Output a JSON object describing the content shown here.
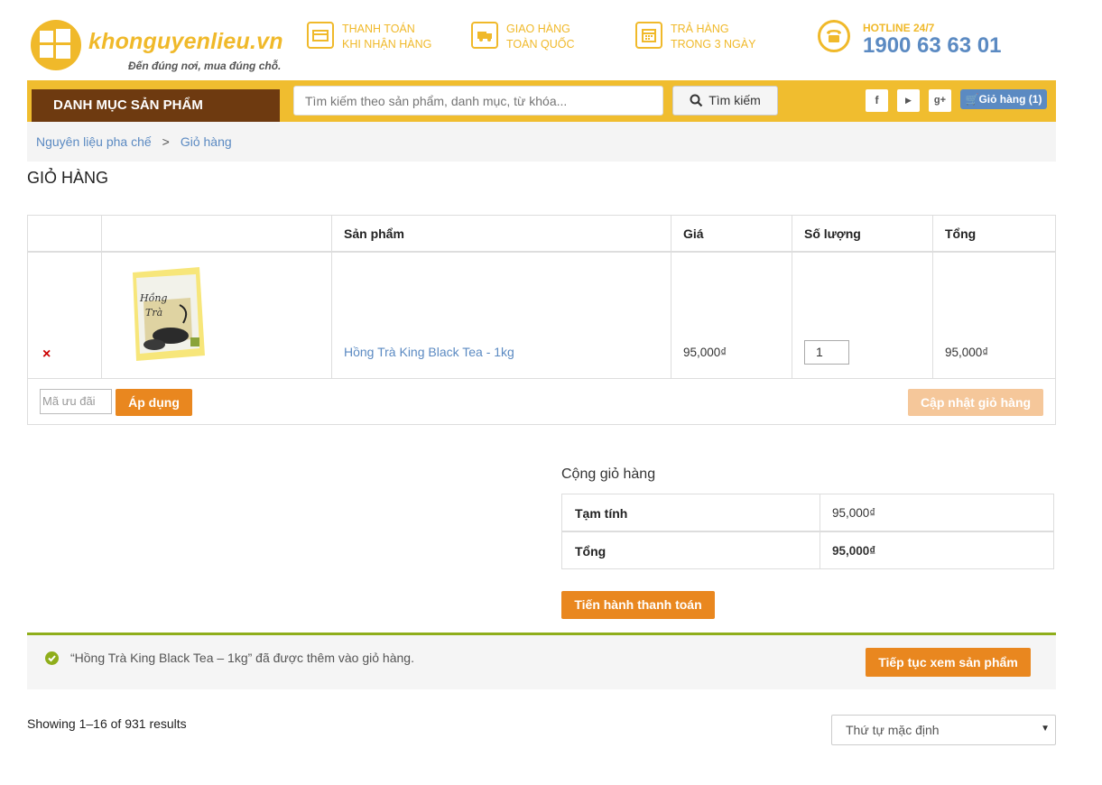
{
  "header": {
    "logo_name": "khonguyenlieu.vn",
    "logo_slogan": "Đến đúng nơi, mua đúng chỗ.",
    "features": [
      {
        "line1": "THANH TOÁN",
        "line2": "KHI NHẬN HÀNG",
        "icon": "credit-card-icon"
      },
      {
        "line1": "GIAO HÀNG",
        "line2": "TOÀN QUỐC",
        "icon": "truck-icon"
      },
      {
        "line1": "TRẢ HÀNG",
        "line2": "TRONG 3 NGÀY",
        "icon": "calendar-icon"
      }
    ],
    "hotline_label": "HOTLINE 24/7",
    "hotline_number": "1900 63 63 01"
  },
  "nav": {
    "category_label": "DANH MỤC SẢN PHẨM",
    "search_placeholder": "Tìm kiếm theo sản phẩm, danh mục, từ khóa...",
    "search_button": "Tìm kiếm",
    "social": [
      "f",
      "▶",
      "g+"
    ],
    "cart_label": "Giỏ hàng (1)"
  },
  "breadcrumb": {
    "home": "Nguyên liệu pha chế",
    "separator": ">",
    "current": "Giỏ hàng"
  },
  "page_title": "GIỎ HÀNG",
  "cart": {
    "headers": {
      "product": "Sản phẩm",
      "price": "Giá",
      "quantity": "Số lượng",
      "total": "Tổng"
    },
    "items": [
      {
        "remove": "×",
        "name": "Hồng Trà King Black Tea - 1kg",
        "price": "95,000₫",
        "quantity": "1",
        "total": "95,000₫"
      }
    ],
    "coupon_placeholder": "Mã ưu đãi",
    "apply_button": "Áp dụng",
    "update_button": "Cập nhật giỏ hàng"
  },
  "totals": {
    "title": "Cộng giỏ hàng",
    "subtotal_label": "Tạm tính",
    "subtotal_value": "95,000₫",
    "total_label": "Tổng",
    "total_value": "95,000₫",
    "checkout_button": "Tiến hành thanh toán"
  },
  "notice": {
    "message": "“Hồng Trà King Black Tea – 1kg” đã được thêm vào giỏ hàng.",
    "continue_button": "Tiếp tục xem sản phẩm"
  },
  "listing": {
    "results": "Showing 1–16 of 931 results",
    "sort_value": "Thứ tự mặc định"
  },
  "colors": {
    "brand_yellow": "#f0bd2f",
    "brand_brown": "#6e3a10",
    "link_blue": "#5b8ac2",
    "button_orange": "#e9871f",
    "success_green": "#8fae1b"
  }
}
